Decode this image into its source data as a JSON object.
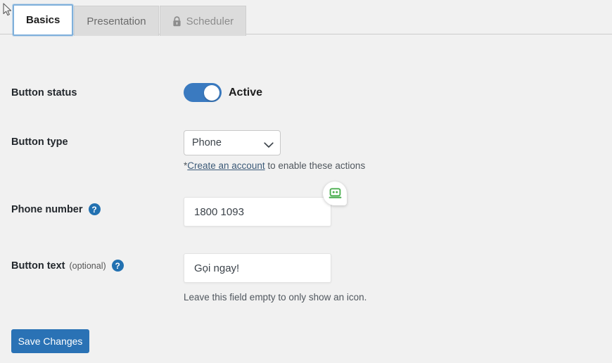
{
  "tabs": [
    {
      "label": "Basics",
      "state": "active",
      "icon": null
    },
    {
      "label": "Presentation",
      "state": "normal",
      "icon": null
    },
    {
      "label": "Scheduler",
      "state": "disabled",
      "icon": "lock-icon"
    }
  ],
  "fields": {
    "button_status": {
      "label": "Button status",
      "toggle_state": "on",
      "toggle_label": "Active"
    },
    "button_type": {
      "label": "Button type",
      "value": "Phone",
      "options": [
        "Phone"
      ],
      "hint_link": "Create an account",
      "hint_prefix": "*",
      "hint_suffix": " to enable these actions"
    },
    "phone_number": {
      "label": "Phone number",
      "help": "?",
      "value": "1800 1093",
      "autofill_icon": "robot-icon"
    },
    "button_text": {
      "label": "Button text",
      "optional": "(optional)",
      "help": "?",
      "value": "Gọi ngay!",
      "hint": "Leave this field empty to only show an icon."
    }
  },
  "actions": {
    "save_label": "Save Changes"
  },
  "colors": {
    "page_bg": "#f1f1f1",
    "accent_blue": "#2271b1",
    "toggle_blue": "#3a7ac0",
    "save_blue": "#2a72b5",
    "robot_green": "#4caf50",
    "tab_inactive_bg": "#dcdcdc",
    "tab_focus_ring": "#7fb0db"
  }
}
